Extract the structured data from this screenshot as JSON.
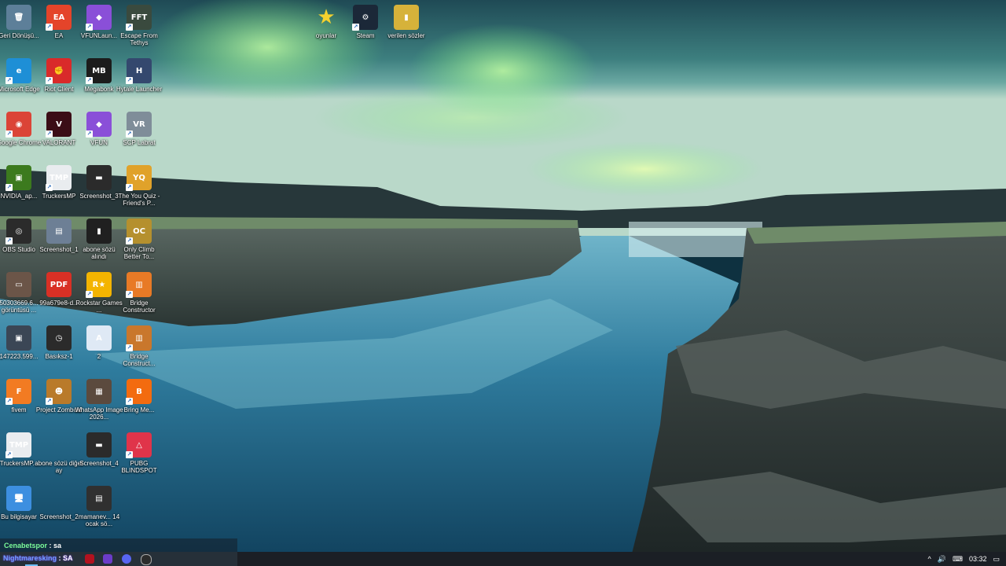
{
  "desktop": {
    "icons": [
      {
        "label": "Geri Dönüşü...",
        "glyph": "🗑",
        "color": "#5d7f99",
        "name": "recycle-bin-icon",
        "shortcut": false
      },
      {
        "label": "EA",
        "glyph": "EA",
        "color": "#e4442a",
        "name": "ea-app-icon",
        "shortcut": true
      },
      {
        "label": "VFUNLaun...",
        "glyph": "◆",
        "color": "#8a4fd8",
        "name": "vfun-launcher-icon",
        "shortcut": true
      },
      {
        "label": "Escape From Tethys",
        "glyph": "FFT",
        "color": "#3a4a3e",
        "name": "escape-from-tethys-icon",
        "shortcut": true
      },
      {
        "label": "Microsoft Edge",
        "glyph": "e",
        "color": "#1e8fd6",
        "name": "edge-icon",
        "shortcut": true
      },
      {
        "label": "Riot Client",
        "glyph": "✊",
        "color": "#d92a2a",
        "name": "riot-client-icon",
        "shortcut": true
      },
      {
        "label": "Megabonk",
        "glyph": "MB",
        "color": "#1c1c1c",
        "name": "megabonk-icon",
        "shortcut": true
      },
      {
        "label": "Hytale Launcher",
        "glyph": "H",
        "color": "#34486e",
        "name": "hytale-launcher-icon",
        "shortcut": true
      },
      {
        "label": "Google Chrome",
        "glyph": "◉",
        "color": "#db4437",
        "name": "chrome-icon",
        "shortcut": true
      },
      {
        "label": "VALORANT",
        "glyph": "V",
        "color": "#3b0d16",
        "name": "valorant-icon",
        "shortcut": true
      },
      {
        "label": "VFUN",
        "glyph": "◆",
        "color": "#8a4fd8",
        "name": "vfun-icon",
        "shortcut": true
      },
      {
        "label": "SCP Labrat",
        "glyph": "VR",
        "color": "#7f8d99",
        "name": "scp-labrat-icon",
        "shortcut": true
      },
      {
        "label": "NVIDIA_ap...",
        "glyph": "▣",
        "color": "#3c7a1e",
        "name": "nvidia-app-icon",
        "shortcut": true
      },
      {
        "label": "TruckersMP",
        "glyph": "TMP",
        "color": "#e9ecef",
        "name": "truckersmp-icon",
        "shortcut": true
      },
      {
        "label": "Screenshot_3",
        "glyph": "▬",
        "color": "#2b2b2b",
        "name": "screenshot-3-icon",
        "shortcut": false
      },
      {
        "label": "The You Quiz - Friend's P...",
        "glyph": "YQ",
        "color": "#e0a22a",
        "name": "you-quiz-icon",
        "shortcut": true
      },
      {
        "label": "OBS Studio",
        "glyph": "◎",
        "color": "#2b2b2b",
        "name": "obs-studio-icon",
        "shortcut": true
      },
      {
        "label": "Screenshot_1",
        "glyph": "▤",
        "color": "#6d7f95",
        "name": "screenshot-1-icon",
        "shortcut": false
      },
      {
        "label": "abone sözü alındı",
        "glyph": "▮",
        "color": "#202020",
        "name": "abone-sozu-alindi-icon",
        "shortcut": false
      },
      {
        "label": "Only Climb Better To...",
        "glyph": "OC",
        "color": "#b5902e",
        "name": "only-climb-icon",
        "shortcut": true
      },
      {
        "label": "50303669.6... görüntüsü ...",
        "glyph": "▭",
        "color": "#6b5548",
        "name": "image-file-icon",
        "shortcut": false
      },
      {
        "label": "99a679e8-d...",
        "glyph": "PDF",
        "color": "#d93025",
        "name": "pdf-file-icon",
        "shortcut": false
      },
      {
        "label": "Rockstar Games ...",
        "glyph": "R★",
        "color": "#f4b400",
        "name": "rockstar-games-icon",
        "shortcut": true
      },
      {
        "label": "Bridge Constructor",
        "glyph": "▥",
        "color": "#e87a26",
        "name": "bridge-constructor-icon",
        "shortcut": true
      },
      {
        "label": "147223.599...",
        "glyph": "▣",
        "color": "#3b4655",
        "name": "image-147223-icon",
        "shortcut": false
      },
      {
        "label": "Basıksz-1",
        "glyph": "◷",
        "color": "#2b2b2b",
        "name": "basiksz-icon",
        "shortcut": false
      },
      {
        "label": "2",
        "glyph": "A",
        "color": "#dfe9f5",
        "name": "text-file-2-icon",
        "shortcut": false
      },
      {
        "label": "Bridge Construct...",
        "glyph": "▥",
        "color": "#c9772c",
        "name": "bridge-constructor-2-icon",
        "shortcut": true
      },
      {
        "label": "fivem",
        "glyph": "F",
        "color": "#f27b22",
        "name": "fivem-icon",
        "shortcut": true
      },
      {
        "label": "Project Zomboid",
        "glyph": "☻",
        "color": "#b97a2a",
        "name": "project-zomboid-icon",
        "shortcut": true
      },
      {
        "label": "WhatsApp Image 2026...",
        "glyph": "▦",
        "color": "#5b4a3e",
        "name": "whatsapp-image-icon",
        "shortcut": false
      },
      {
        "label": "Bring Me...",
        "glyph": "B",
        "color": "#f36b0f",
        "name": "bring-me-icon",
        "shortcut": true
      },
      {
        "label": "TruckersMP...",
        "glyph": "TMP",
        "color": "#e9ecef",
        "name": "truckersmp-2-icon",
        "shortcut": true
      },
      {
        "label": "abone sözü diğer ay",
        "glyph": "",
        "color": "transparent",
        "name": "abone-sozu-diger-ay-icon",
        "shortcut": false
      },
      {
        "label": "Screenshot_4",
        "glyph": "▬",
        "color": "#2b2b2b",
        "name": "screenshot-4-icon",
        "shortcut": false
      },
      {
        "label": "PUBG BLINDSPOT",
        "glyph": "△",
        "color": "#e0344a",
        "name": "pubg-blindspot-icon",
        "shortcut": true
      },
      {
        "label": "Bu bilgisayar",
        "glyph": "🖥",
        "color": "#3d8fe0",
        "name": "this-pc-icon",
        "shortcut": false
      },
      {
        "label": "Screenshot_2",
        "glyph": "",
        "color": "transparent",
        "name": "screenshot-2-icon",
        "shortcut": false
      },
      {
        "label": "mamanev... 14 ocak sö...",
        "glyph": "▤",
        "color": "#303030",
        "name": "mamanev-file-icon",
        "shortcut": false
      },
      {
        "label": "oyunlar",
        "glyph": "★",
        "color": "transparent",
        "name": "oyunlar-folder-icon",
        "shortcut": false
      },
      {
        "label": "Steam",
        "glyph": "⚙",
        "color": "#1b2838",
        "name": "steam-icon",
        "shortcut": true
      },
      {
        "label": "verilen sözler",
        "glyph": "▮",
        "color": "#d6b23a",
        "name": "verilen-sozler-folder-icon",
        "shortcut": false
      }
    ]
  },
  "chat": {
    "user": "Cenabetspor",
    "message": ": sa"
  },
  "taskbar": {
    "overlay_name": "Nightmaresking",
    "overlay_text": ": SA",
    "clock": "03:32"
  }
}
